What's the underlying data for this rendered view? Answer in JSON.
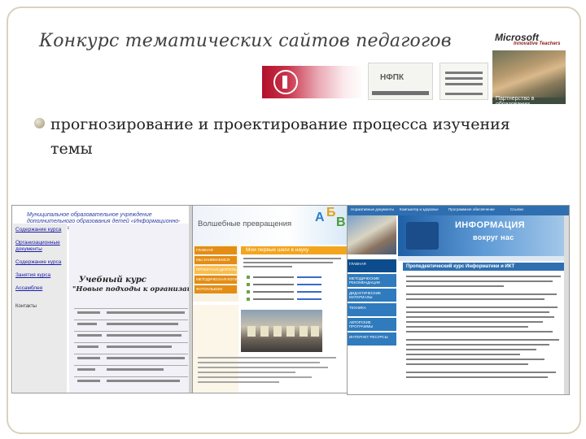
{
  "slide": {
    "title": "Конкурс тематических сайтов педагогов",
    "bullet": "прогнозирование и проектирование процесса изучения темы"
  },
  "logos": {
    "microsoft": {
      "brand": "Microsoft",
      "tagline": "Innovative Teachers",
      "caption": "Партнерство в образовании"
    },
    "nfpk": "НФПК"
  },
  "screenshots": {
    "site1": {
      "header": "Муниципальное образовательное учреждение дополнительного образования детей «Информационно-методический центр»",
      "sidebar_links": [
        "Содержание курса",
        "Организационные документы",
        "Содержание курса",
        "Занятия курса",
        "Ассамблея"
      ],
      "feedback": "Контакты",
      "doc_title": "Учебный курс",
      "doc_subtitle": "\"Новые подходы к организации мет"
    },
    "site2": {
      "banner_title": "Волшебные превращения",
      "abc": [
        "А",
        "Б",
        "В"
      ],
      "nav_items": [
        "ГЛАВНАЯ",
        "МЫ ЗАНИМАЕМСЯ",
        "ПРОЕКТНАЯ ДЕЯТЕЛЬНОСТЬ",
        "МЕТОДИЧЕСКАЯ КОПИЛКА",
        "ФОТОАЛЬБОМ"
      ],
      "section_title": "Мои первые шаги в науку"
    },
    "site3": {
      "topbar": [
        "Нормативные документы",
        "Компьютер и здоровье",
        "Программное обеспечение",
        "Ссылки"
      ],
      "menu_items": [
        "ГЛАВНАЯ",
        "МЕТОДИЧЕСКИЕ РЕКОМЕНДАЦИИ",
        "ДИДАКТИЧЕСКИЕ МАТЕРИАЛЫ",
        "ТЕХНИКА",
        "АВТОРСКИЕ ПРОГРАММЫ",
        "ИНТЕРНЕТ РЕСУРСЫ"
      ],
      "banner_line1": "ИНФОРМАЦИЯ",
      "banner_line2": "вокруг нас",
      "section_title": "Пропедевтический курс Информатики и ИКТ"
    }
  },
  "colors": {
    "header_band": "#ebe8db",
    "frame": "#d8d2bd",
    "accent_orange": "#f3a51f",
    "accent_blue": "#2f6fb1"
  }
}
